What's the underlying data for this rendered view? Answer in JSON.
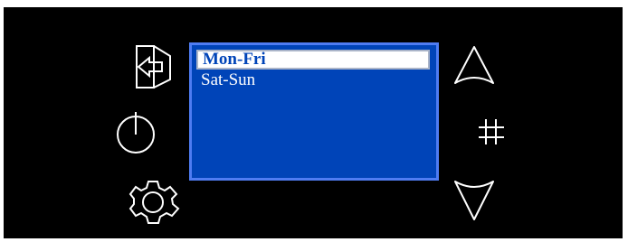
{
  "device": {
    "background_color": "#000000",
    "icon_color": "#ffffff"
  },
  "left_buttons": [
    {
      "name": "back-icon"
    },
    {
      "name": "power-icon"
    },
    {
      "name": "gear-icon"
    }
  ],
  "right_buttons": [
    {
      "name": "up-arrow-icon"
    },
    {
      "name": "hash-icon"
    },
    {
      "name": "down-arrow-icon"
    }
  ],
  "screen": {
    "background_color": "#0044b8",
    "border_color": "#4f7cf2",
    "menu": {
      "selected_index": 0,
      "items": [
        {
          "label": "Mon-Fri"
        },
        {
          "label": "Sat-Sun"
        }
      ]
    }
  }
}
